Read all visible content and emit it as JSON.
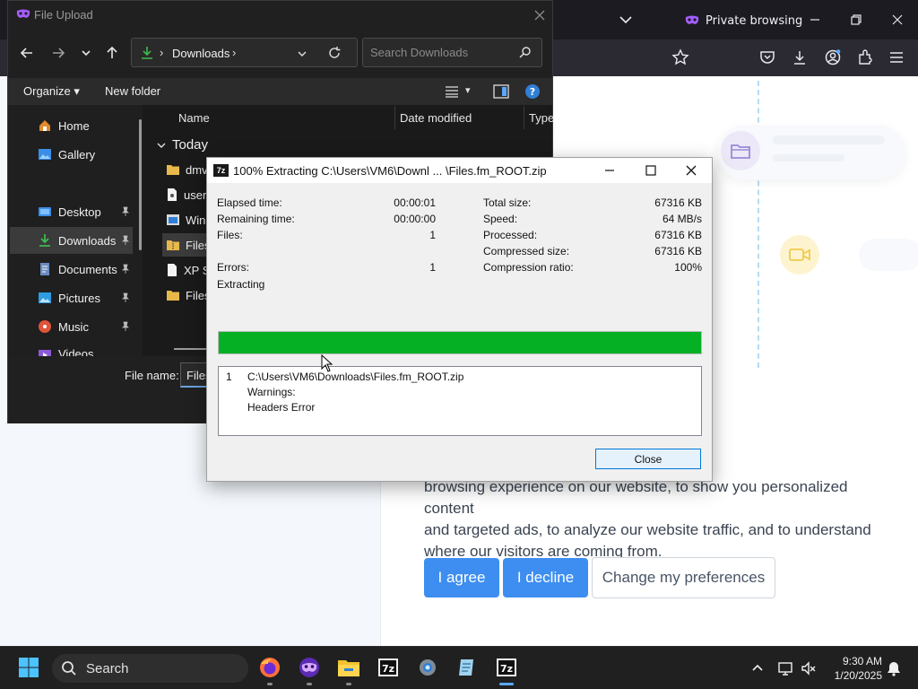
{
  "browser": {
    "mode_label": "Private browsing",
    "colors": {
      "accent": "#3d8ef0",
      "private_purple": "#a45dff"
    }
  },
  "cookie_banner": {
    "text": "ies to improve your\nbrowsing experience on our website, to show you personalized content\nand targeted ads, to analyze our website traffic, and to understand\nwhere our visitors are coming from.",
    "agree_label": "I agree",
    "decline_label": "I decline",
    "preferences_label": "Change my preferences"
  },
  "file_upload": {
    "title": "File Upload",
    "address": "Downloads",
    "search_placeholder": "Search Downloads",
    "organize_label": "Organize",
    "new_folder_label": "New folder",
    "sidebar": {
      "items": [
        {
          "label": "Home",
          "icon": "home-icon"
        },
        {
          "label": "Gallery",
          "icon": "gallery-icon"
        },
        {
          "label": "Desktop",
          "icon": "desktop-icon"
        },
        {
          "label": "Downloads",
          "icon": "download-icon"
        },
        {
          "label": "Documents",
          "icon": "documents-icon"
        },
        {
          "label": "Pictures",
          "icon": "pictures-icon"
        },
        {
          "label": "Music",
          "icon": "music-icon"
        },
        {
          "label": "Videos",
          "icon": "videos-icon"
        }
      ]
    },
    "columns": {
      "name": "Name",
      "date_modified": "Date modified",
      "type": "Type"
    },
    "group": "Today",
    "files": [
      {
        "name": "dmv",
        "icon": "folder-icon"
      },
      {
        "name": "user",
        "icon": "text-file-icon"
      },
      {
        "name": "Wind",
        "icon": "app-file-icon"
      },
      {
        "name": "Files",
        "icon": "zip-folder-icon"
      },
      {
        "name": "XP S",
        "icon": "document-icon"
      },
      {
        "name": "Files",
        "icon": "folder-icon"
      }
    ],
    "file_name_label": "File name:",
    "file_name_value": "Files.f"
  },
  "sevenzip": {
    "title": "100% Extracting C:\\Users\\VM6\\Downl ... \\Files.fm_ROOT.zip",
    "left": {
      "elapsed_label": "Elapsed time:",
      "elapsed_value": "00:00:01",
      "remaining_label": "Remaining time:",
      "remaining_value": "00:00:00",
      "files_label": "Files:",
      "files_value": "1",
      "errors_label": "Errors:",
      "errors_value": "1",
      "status": "Extracting"
    },
    "right": {
      "total_label": "Total size:",
      "total_value": "67316 KB",
      "speed_label": "Speed:",
      "speed_value": "64 MB/s",
      "processed_label": "Processed:",
      "processed_value": "67316 KB",
      "compressed_label": "Compressed size:",
      "compressed_value": "67316 KB",
      "ratio_label": "Compression ratio:",
      "ratio_value": "100%"
    },
    "progress_percent": 100,
    "log": {
      "index": "1",
      "path": "C:\\Users\\VM6\\Downloads\\Files.fm_ROOT.zip",
      "warnings": "Warnings:",
      "error": "Headers Error"
    },
    "close_label": "Close"
  },
  "taskbar": {
    "search_label": "Search",
    "time": "9:30 AM",
    "date": "1/20/2025"
  }
}
